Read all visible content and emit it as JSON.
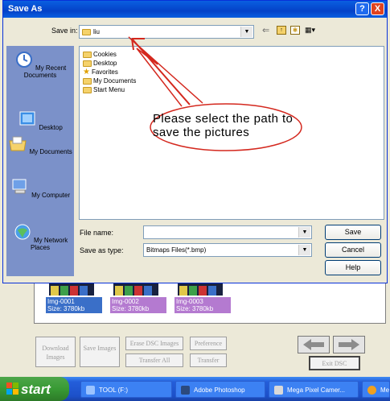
{
  "dialog": {
    "title": "Save As",
    "help_label": "?",
    "close_label": "X",
    "save_in_label": "Save in:",
    "save_in_value": "liu",
    "folders": [
      "Cookies",
      "Desktop",
      "Favorites",
      "My Documents",
      "Start Menu"
    ],
    "file_name_label": "File name:",
    "file_name_value": "",
    "save_as_type_label": "Save as type:",
    "save_as_type_value": "Bitmaps Files(*.bmp)",
    "save_button": "Save",
    "cancel_button": "Cancel",
    "help_button": "Help",
    "places": [
      {
        "label": "My Recent Documents",
        "icon": "recent-documents-icon"
      },
      {
        "label": "Desktop",
        "icon": "desktop-icon"
      },
      {
        "label": "My Documents",
        "icon": "my-documents-icon"
      },
      {
        "label": "My Computer",
        "icon": "my-computer-icon"
      },
      {
        "label": "My Network Places",
        "icon": "network-places-icon"
      }
    ]
  },
  "callout": {
    "text": "Please select the path to save the pictures"
  },
  "app": {
    "thumbnails": [
      {
        "name": "Img-0001",
        "size": "Size: 3780kb",
        "color": "#3a6fc8"
      },
      {
        "name": "Img-0002",
        "size": "Size: 3780kb",
        "color": "#b47ad0"
      },
      {
        "name": "Img-0003",
        "size": "Size: 3780kb",
        "color": "#b47ad0"
      }
    ],
    "buttons": {
      "download": "Download Images",
      "save": "Save Images",
      "erase": "Erase DSC Images",
      "preference": "Preference",
      "transfer_all": "Transfer All",
      "transfer": "Transfer",
      "exit": "Exit DSC"
    }
  },
  "taskbar": {
    "start": "start",
    "tasks": [
      {
        "label": "TOOL (F:)",
        "icon_color": "#9bc3ff"
      },
      {
        "label": "Adobe Photoshop",
        "icon_color": "#2c4a7d"
      },
      {
        "label": "Mega Pixel Camer...",
        "icon_color": "#d9d9d9"
      },
      {
        "label": "Me",
        "icon_color": "#f0a020"
      }
    ]
  },
  "colors": {
    "title_blue": "#0442c8",
    "places_bar": "#7b91c9",
    "callout_red": "#d4281e",
    "taskbar": "#245edb"
  }
}
